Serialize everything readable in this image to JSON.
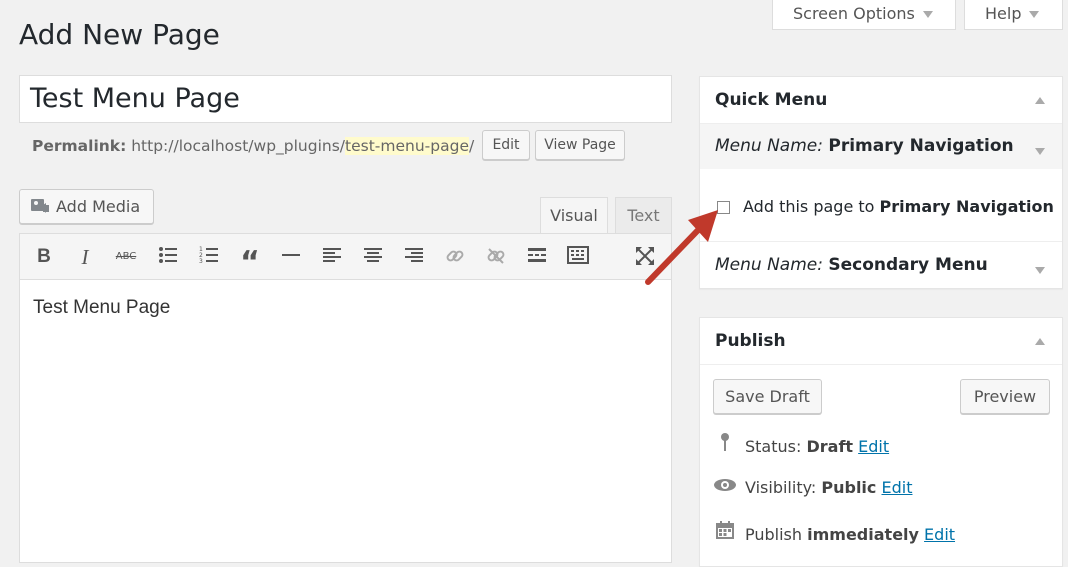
{
  "screen_meta": {
    "screen_options_label": "Screen Options",
    "help_label": "Help"
  },
  "page_title": "Add New Page",
  "post_title": "Test Menu Page",
  "permalink": {
    "label": "Permalink:",
    "base_url": "http://localhost/wp_plugins/",
    "slug": "test-menu-page",
    "trailing": "/",
    "edit_label": "Edit",
    "view_label": "View Page"
  },
  "editor": {
    "add_media_label": "Add Media",
    "tab_visual": "Visual",
    "tab_text": "Text",
    "content": "Test Menu Page",
    "toolbar_icons": [
      "bold-icon",
      "italic-icon",
      "strikethrough-icon",
      "bullet-list-icon",
      "numbered-list-icon",
      "blockquote-icon",
      "horizontal-rule-icon",
      "align-left-icon",
      "align-center-icon",
      "align-right-icon",
      "insert-link-icon",
      "remove-link-icon",
      "read-more-icon",
      "toolbar-toggle-icon",
      "fullscreen-icon"
    ]
  },
  "quick_menu": {
    "title": "Quick Menu",
    "menu_name_prefix": "Menu Name:",
    "menus": [
      {
        "name": "Primary Navigation"
      },
      {
        "name": "Secondary Menu"
      }
    ],
    "checkbox_label_prefix": "Add this page to",
    "checkbox_label_menu": "Primary Navigation",
    "checkbox_checked": false
  },
  "publish": {
    "title": "Publish",
    "save_draft_label": "Save Draft",
    "preview_label": "Preview",
    "status_label": "Status:",
    "status_value": "Draft",
    "visibility_label": "Visibility:",
    "visibility_value": "Public",
    "publish_label": "Publish",
    "publish_value": "immediately",
    "edit_label": "Edit"
  },
  "colors": {
    "link": "#0073aa",
    "arrow": "#c0392b",
    "slug_highlight": "#fffbcc"
  }
}
